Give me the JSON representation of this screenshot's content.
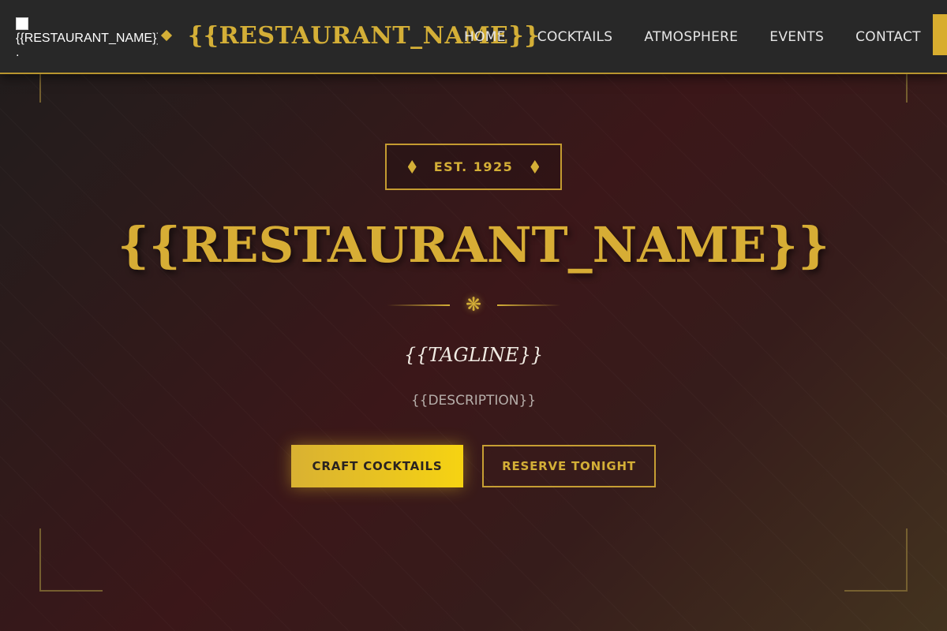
{
  "header": {
    "logo_alt": "{{RESTAURANT_NAME}}",
    "logo_broken_char": ".",
    "brand_name": "{{RESTAURANT_NAME}}",
    "nav": [
      {
        "label": "HOME"
      },
      {
        "label": "COCKTAILS"
      },
      {
        "label": "ATMOSPHERE"
      },
      {
        "label": "EVENTS"
      },
      {
        "label": "CONTACT"
      }
    ]
  },
  "hero": {
    "badge_text": "EST. 1925",
    "title": "{{RESTAURANT_NAME}}",
    "ornament_icon": "flower-asterisk-icon",
    "ornament_glyph": "❋",
    "tagline": "{{TAGLINE}}",
    "description": "{{DESCRIPTION}}",
    "primary_button": "CRAFT COCKTAILS",
    "secondary_button": "RESERVE TONIGHT"
  },
  "colors": {
    "accent_gold": "#d4af37",
    "button_gold_light": "#f6d312",
    "nav_background": "#282828",
    "hero_burgundy": "#3b1719"
  }
}
